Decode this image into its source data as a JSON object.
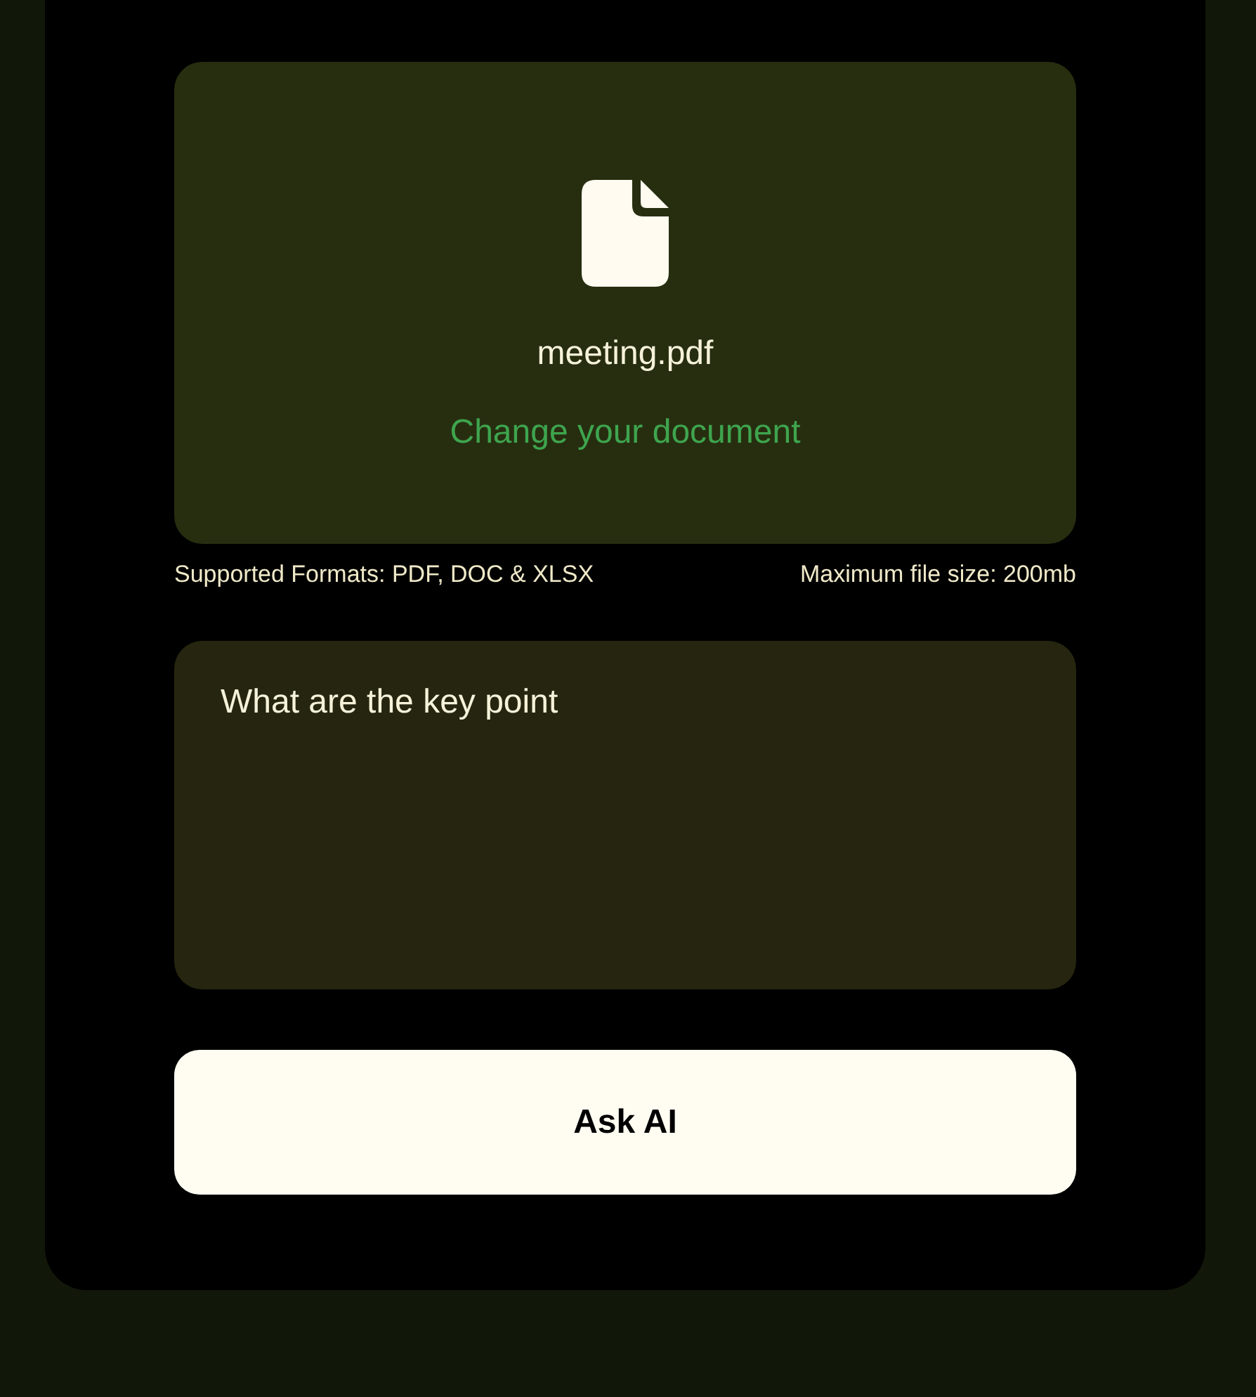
{
  "upload": {
    "file_name": "meeting.pdf",
    "change_link": "Change your document"
  },
  "hints": {
    "formats": "Supported Formats: PDF, DOC & XLSX",
    "max_size": "Maximum file size: 200mb"
  },
  "question": {
    "value": "What are the key point"
  },
  "button": {
    "label": "Ask AI"
  }
}
